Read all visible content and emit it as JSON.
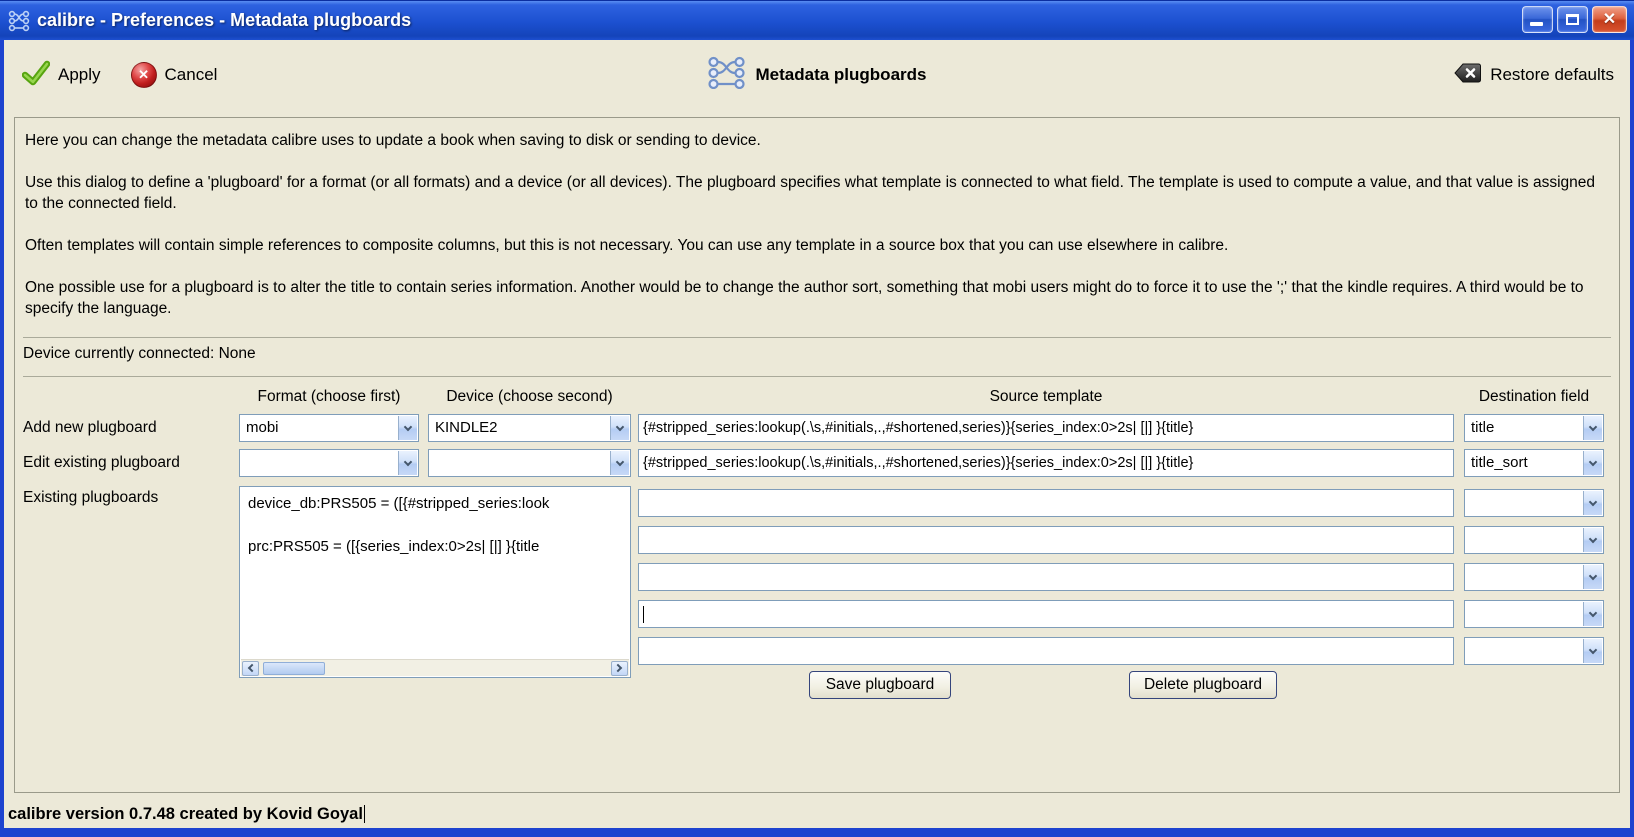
{
  "window": {
    "title": "calibre - Preferences - Metadata plugboards",
    "status_line": "calibre version 0.7.48 created by Kovid Goyal"
  },
  "toolbar": {
    "apply_label": "Apply",
    "cancel_label": "Cancel",
    "page_title": "Metadata plugboards",
    "restore_label": "Restore defaults"
  },
  "intro": {
    "p1": "Here you can change the metadata calibre uses to update a book when saving to disk or sending to device.",
    "p2": "Use this dialog to define a 'plugboard' for a format (or all formats) and a device (or all devices). The plugboard specifies what template is connected to what field. The template is used to compute a value, and that value is assigned to the connected field.",
    "p3": "Often templates will contain simple references to composite columns, but this is not necessary. You can use any template in a source box that you can use elsewhere in calibre.",
    "p4": "One possible use for a plugboard is to alter the title to contain series information. Another would be to change the author sort, something that mobi users might do to force it to use the ';' that the kindle requires. A third would be to specify the language.",
    "device_connected": "Device currently connected: None"
  },
  "form": {
    "headers": {
      "format": "Format (choose first)",
      "device": "Device (choose second)",
      "source": "Source template",
      "destination": "Destination field"
    },
    "add_row": {
      "label": "Add new plugboard",
      "format": "mobi",
      "device": "KINDLE2",
      "source": "{#stripped_series:lookup(.\\s,#initials,.,#shortened,series)}{series_index:0>2s| [|] }{title}",
      "destination": "title"
    },
    "edit_row": {
      "label": "Edit existing plugboard",
      "format": "",
      "device": "",
      "source": "{#stripped_series:lookup(.\\s,#initials,.,#shortened,series)}{series_index:0>2s| [|] }{title}",
      "destination": "title_sort"
    },
    "existing": {
      "label": "Existing plugboards",
      "items": [
        "device_db:PRS505 = ([{#stripped_series:look",
        "prc:PRS505 = ([{series_index:0>2s| [|] }{title"
      ]
    },
    "save_button": "Save plugboard",
    "delete_button": "Delete plugboard"
  },
  "colors": {
    "titlebar_blue": "#1c50d0",
    "window_border": "#1d43cf",
    "background": "#ece9d8",
    "input_border": "#7f9db9",
    "icon_blue": "#7090c8",
    "apply_green": "#57a410",
    "cancel_red": "#c01d1d",
    "close_red": "#d8532f"
  },
  "icons": {
    "titlebar_left": "calibre-logo-icon",
    "apply": "check-icon",
    "cancel": "cancel-circle-icon",
    "page": "plugboard-icon",
    "restore": "backspace-x-icon",
    "combo": "chevron-down-icon",
    "scroll_left": "chevron-left-icon",
    "scroll_right": "chevron-right-icon"
  }
}
